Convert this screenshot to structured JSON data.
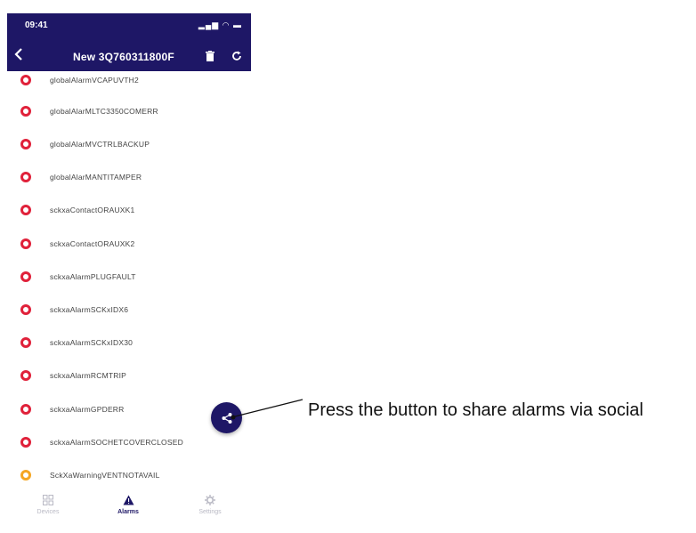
{
  "status": {
    "time": "09:41",
    "icons": "▂▄▆ ◠ ▬"
  },
  "header": {
    "title": "New 3Q760311800F"
  },
  "alarms": [
    {
      "label": "globalAlarmVCAPUVTH2",
      "level": "alarm"
    },
    {
      "label": "globalAlarMLTC3350COMERR",
      "level": "alarm"
    },
    {
      "label": "globalAlarMVCTRLBACKUP",
      "level": "alarm"
    },
    {
      "label": "globalAlarMANTITAMPER",
      "level": "alarm"
    },
    {
      "label": "sckxaContactORAUXK1",
      "level": "alarm"
    },
    {
      "label": "sckxaContactORAUXK2",
      "level": "alarm"
    },
    {
      "label": "sckxaAlarmPLUGFAULT",
      "level": "alarm"
    },
    {
      "label": "sckxaAlarmSCKxIDX6",
      "level": "alarm"
    },
    {
      "label": "sckxaAlarmSCKxIDX30",
      "level": "alarm"
    },
    {
      "label": "sckxaAlarmRCMTRIP",
      "level": "alarm"
    },
    {
      "label": "sckxaAlarmGPDERR",
      "level": "alarm"
    },
    {
      "label": "sckxaAlarmSOCHETCOVERCLOSED",
      "level": "alarm"
    },
    {
      "label": "SckXaWarningVENTNOTAVAIL",
      "level": "warning"
    }
  ],
  "bottom_nav": {
    "devices": "Devices",
    "alarms": "Alarms",
    "settings": "Settings",
    "active": "alarms"
  },
  "callout": {
    "text": "Press the button to share alarms via social"
  },
  "colors": {
    "primary": "#1e1766",
    "alarm": "#e0213a",
    "warning": "#f5a623"
  }
}
